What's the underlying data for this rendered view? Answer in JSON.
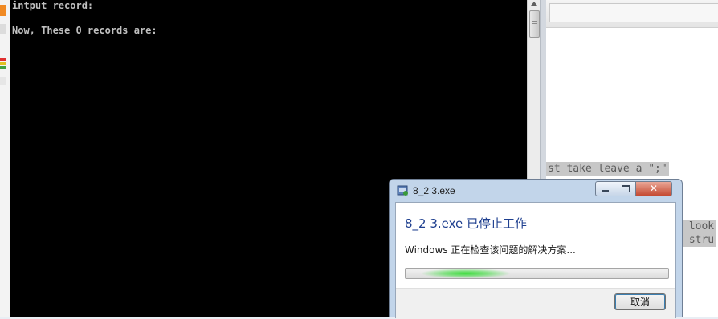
{
  "console": {
    "lines": [
      "intput record:",
      "Now, These 0 records are:"
    ]
  },
  "editor": {
    "line1": "st take leave a \";\"",
    "line2": " look",
    "line3": " stru"
  },
  "dialog": {
    "title": "8_2 3.exe",
    "heading": "8_2 3.exe 已停止工作",
    "message": "Windows 正在检查该问题的解决方案...",
    "progress": 0.12,
    "cancel_label": "取消",
    "close_glyph": "✕",
    "icons": {
      "app": "app-icon",
      "minimize": "minimize-icon",
      "maximize": "maximize-icon",
      "close": "close-icon"
    }
  },
  "colors": {
    "console_bg": "#000000",
    "console_text": "#c0c0c0",
    "heading": "#1e3f8f",
    "progress_glow": "#3fdc3f"
  }
}
